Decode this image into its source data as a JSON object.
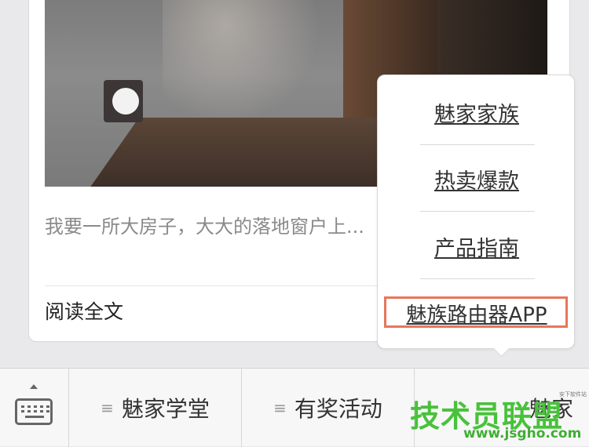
{
  "article": {
    "excerpt": "我要一所大房子，大大的落地窗户上...",
    "read_all": "阅读全文"
  },
  "popup_menu": {
    "items": [
      "魅家家族",
      "热卖爆款",
      "产品指南",
      "魅族路由器APP"
    ],
    "highlighted_index": 3
  },
  "bottom_bar": {
    "keyboard_icon": "keyboard-icon",
    "tabs": [
      {
        "label": "魅家学堂"
      },
      {
        "label": "有奖活动"
      },
      {
        "label": "魅家"
      }
    ]
  },
  "watermark": {
    "text": "技术员联盟",
    "url": "www.jsgho.com",
    "tiny": "安下软件站"
  },
  "colors": {
    "highlight_border": "#e8765c",
    "watermark_green": "#48c23a"
  }
}
